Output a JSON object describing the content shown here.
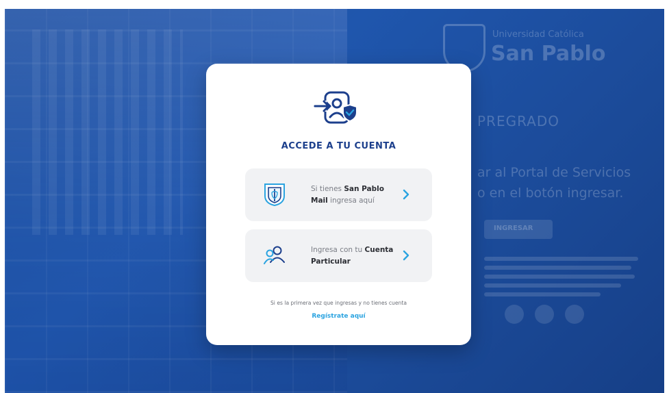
{
  "background": {
    "university_small": "Universidad Católica",
    "university_name": "San Pablo",
    "pregrado": "PREGRADO",
    "portal_line1": "ar al Portal de Servicios",
    "portal_line2": "o en el botón ingresar.",
    "ingresar_button": "INGRESAR"
  },
  "card": {
    "header_icon": "user-login-shield-icon",
    "title": "ACCEDE A TU CUENTA",
    "options": [
      {
        "icon": "san-pablo-shield-icon",
        "text_prefix": "Si tienes ",
        "text_bold": "San Pablo Mail",
        "text_suffix": " ingresa aquí"
      },
      {
        "icon": "users-icon",
        "text_prefix": "Ingresa con tu ",
        "text_bold": "Cuenta Particular",
        "text_suffix": ""
      }
    ],
    "footer_text": "Si es la primera vez que ingresas y no tienes cuenta",
    "register_link": "Regístrate aquí"
  },
  "colors": {
    "background_blue": "#1c4fa0",
    "title_navy": "#1c3f8c",
    "accent_blue": "#2aa3e0",
    "option_bg": "#f1f2f4"
  }
}
